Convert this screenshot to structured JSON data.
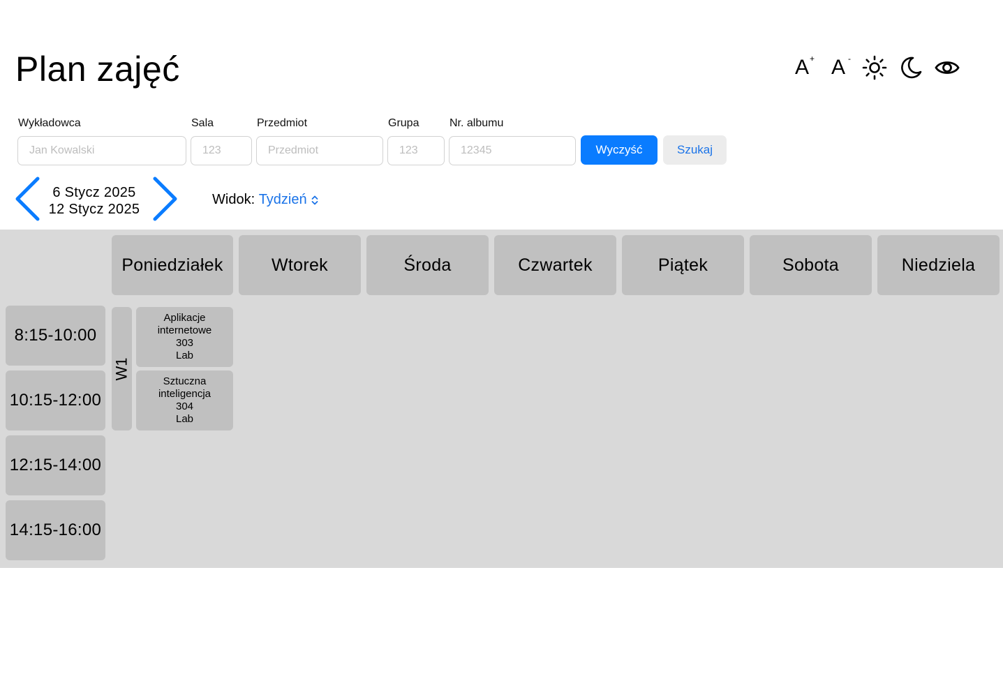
{
  "header": {
    "title": "Plan zajęć"
  },
  "accessibility": {
    "font_increase": {
      "letter": "A",
      "sign": "+"
    },
    "font_decrease": {
      "letter": "A",
      "sign": "-"
    },
    "icons": [
      "font-increase-icon",
      "font-decrease-icon",
      "sun-icon",
      "moon-icon",
      "eye-icon"
    ]
  },
  "filters": {
    "lecturer": {
      "label": "Wykładowca",
      "placeholder": "Jan Kowalski",
      "value": ""
    },
    "room": {
      "label": "Sala",
      "placeholder": "123",
      "value": ""
    },
    "subject": {
      "label": "Przedmiot",
      "placeholder": "Przedmiot",
      "value": ""
    },
    "group": {
      "label": "Grupa",
      "placeholder": "123",
      "value": ""
    },
    "album": {
      "label": "Nr. albumu",
      "placeholder": "12345",
      "value": ""
    },
    "clear_label": "Wyczyść",
    "search_label": "Szukaj"
  },
  "navigation": {
    "range_start": "6 Stycz 2025",
    "range_end": "12 Stycz 2025",
    "view_label": "Widok:",
    "view_value": "Tydzień"
  },
  "calendar": {
    "days": [
      "Poniedziałek",
      "Wtorek",
      "Środa",
      "Czwartek",
      "Piątek",
      "Sobota",
      "Niedziela"
    ],
    "time_slots": [
      "8:15-10:00",
      "10:15-12:00",
      "12:15-14:00",
      "14:15-16:00"
    ],
    "group_label": "W1",
    "events": [
      {
        "line1": "Aplikacje",
        "line2": "internetowe",
        "room": "303",
        "type": "Lab"
      },
      {
        "line1": "Sztuczna",
        "line2": "inteligencja",
        "room": "304",
        "type": "Lab"
      }
    ]
  },
  "colors": {
    "accent": "#0a7cff",
    "link": "#1a73e8",
    "calendar_bg": "#d9d9d9",
    "cell_bg": "#c0c0c0"
  }
}
